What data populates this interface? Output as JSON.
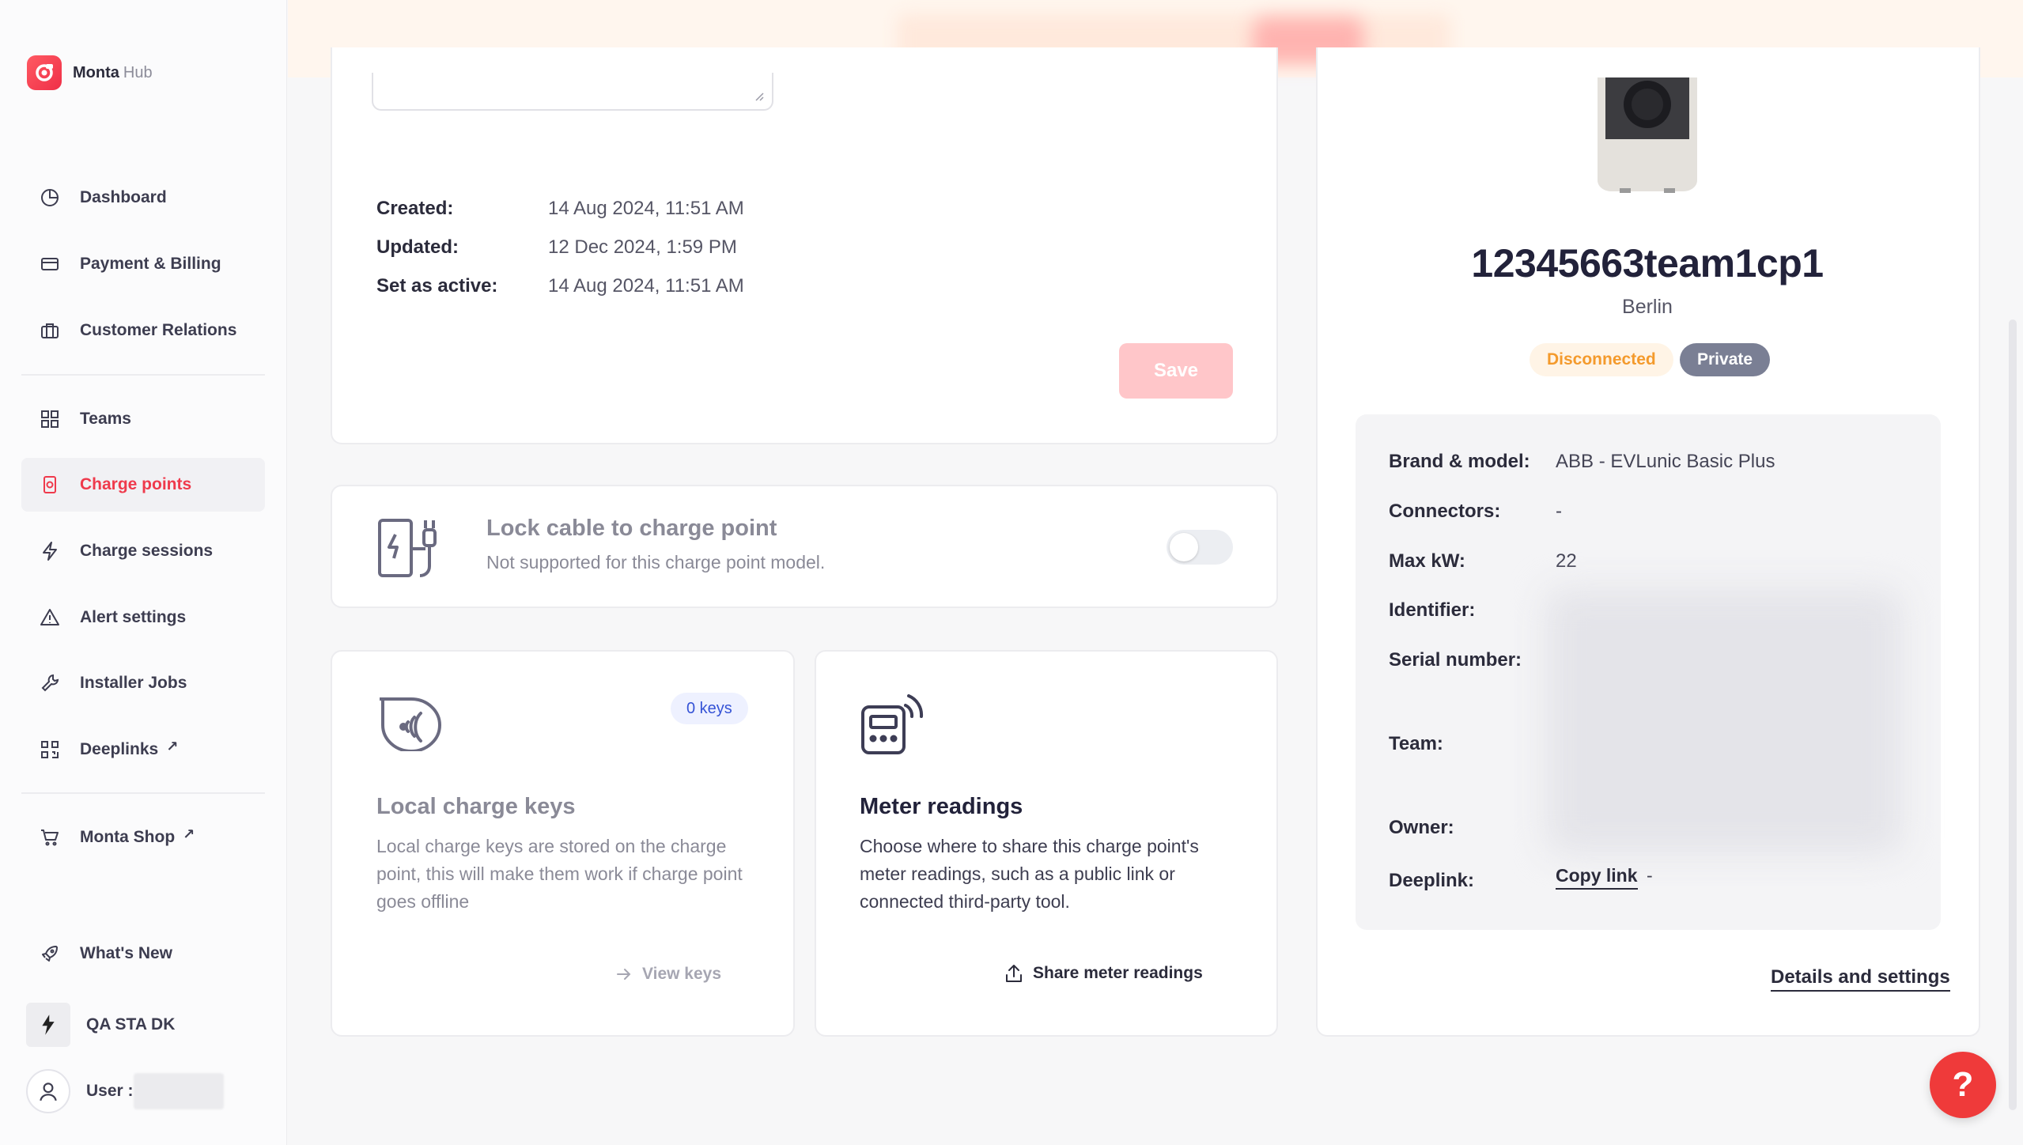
{
  "brand": {
    "name": "Monta",
    "sub": "Hub"
  },
  "sidebar": {
    "items": [
      {
        "label": "Dashboard",
        "icon": "pie-chart-icon"
      },
      {
        "label": "Payment & Billing",
        "icon": "credit-card-icon"
      },
      {
        "label": "Customer Relations",
        "icon": "briefcase-icon"
      },
      {
        "label": "Teams",
        "icon": "grid-icon"
      },
      {
        "label": "Charge points",
        "icon": "charge-point-icon",
        "active": true
      },
      {
        "label": "Charge sessions",
        "icon": "lightning-icon"
      },
      {
        "label": "Alert settings",
        "icon": "alert-icon"
      },
      {
        "label": "Installer Jobs",
        "icon": "wrench-icon"
      },
      {
        "label": "Deeplinks",
        "icon": "qr-icon",
        "external": "↗"
      },
      {
        "label": "Monta Shop",
        "icon": "cart-icon",
        "external": "↗"
      },
      {
        "label": "What's New",
        "icon": "rocket-icon"
      }
    ],
    "org": "QA STA DK",
    "user": "User :"
  },
  "meta": {
    "created_label": "Created:",
    "created_value": "14 Aug 2024, 11:51 AM",
    "updated_label": "Updated:",
    "updated_value": "12 Dec 2024, 1:59 PM",
    "active_label": "Set as active:",
    "active_value": "14 Aug 2024, 11:51 AM",
    "save_label": "Save"
  },
  "lock_cable": {
    "title": "Lock cable to charge point",
    "subtitle": "Not supported for this charge point model.",
    "enabled": false
  },
  "local_keys": {
    "badge": "0 keys",
    "title": "Local charge keys",
    "desc": "Local charge keys are stored on the charge point, this will make them work if charge point goes offline",
    "action": "View keys"
  },
  "meter": {
    "title": "Meter readings",
    "desc": "Choose where to share this charge point's meter readings, such as a public link or connected third-party tool.",
    "action": "Share meter readings"
  },
  "charge_point": {
    "name": "12345663team1cp1",
    "city": "Berlin",
    "status": "Disconnected",
    "visibility": "Private",
    "details": {
      "brand_label": "Brand & model:",
      "brand_value": "ABB - EVLunic Basic Plus",
      "connectors_label": "Connectors:",
      "connectors_value": "-",
      "maxkw_label": "Max kW:",
      "maxkw_value": "22",
      "identifier_label": "Identifier:",
      "serial_label": "Serial number:",
      "team_label": "Team:",
      "owner_label": "Owner:",
      "deeplink_label": "Deeplink:",
      "copy_link": "Copy link",
      "deeplink_sep": "-"
    },
    "details_link": "Details and settings"
  },
  "help": "?"
}
